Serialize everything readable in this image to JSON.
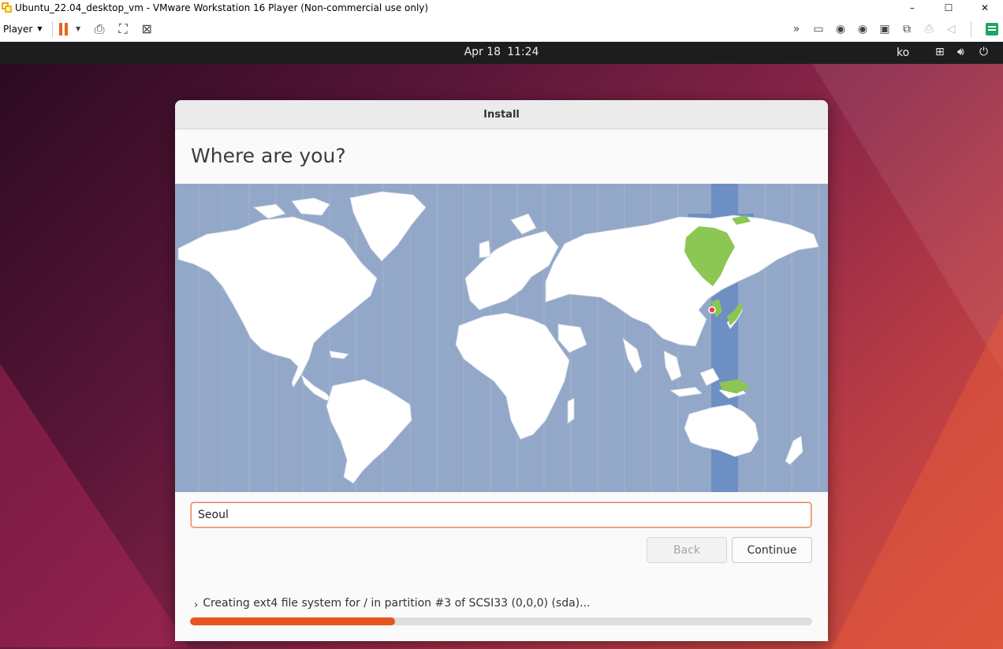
{
  "window": {
    "title": "Ubuntu_22.04_desktop_vm - VMware Workstation 16 Player (Non-commercial use only)",
    "minimize": "–",
    "maximize": "☐",
    "close": "✕"
  },
  "toolbar": {
    "player_label": "Player",
    "left_icons": [
      "send-ctrl-alt-del-icon",
      "fit-guest-icon",
      "unity-icon"
    ],
    "right_icons": [
      "more-chevrons-icon",
      "hard-disk-icon",
      "cd-dvd-icon",
      "cd-dvd-2-icon",
      "floppy-icon",
      "network-adapter-icon",
      "printer-icon",
      "sound-icon",
      "library-icon"
    ]
  },
  "ubuntu_topbar": {
    "date": "Apr 18",
    "time": "11:24",
    "input_language": "ko"
  },
  "installer": {
    "title": "Install",
    "heading": "Where are you?",
    "timezone_value": "Seoul",
    "back_label": "Back",
    "continue_label": "Continue",
    "status_text": "Creating ext4 file system for / in partition #3 of SCSI33 (0,0,0) (sda)...",
    "progress": 0.33,
    "colors": {
      "accent": "#e95420",
      "ocean": "#93a8c8",
      "selected_zone": "#6d8fc4",
      "highlight_land": "#8cc653"
    }
  }
}
